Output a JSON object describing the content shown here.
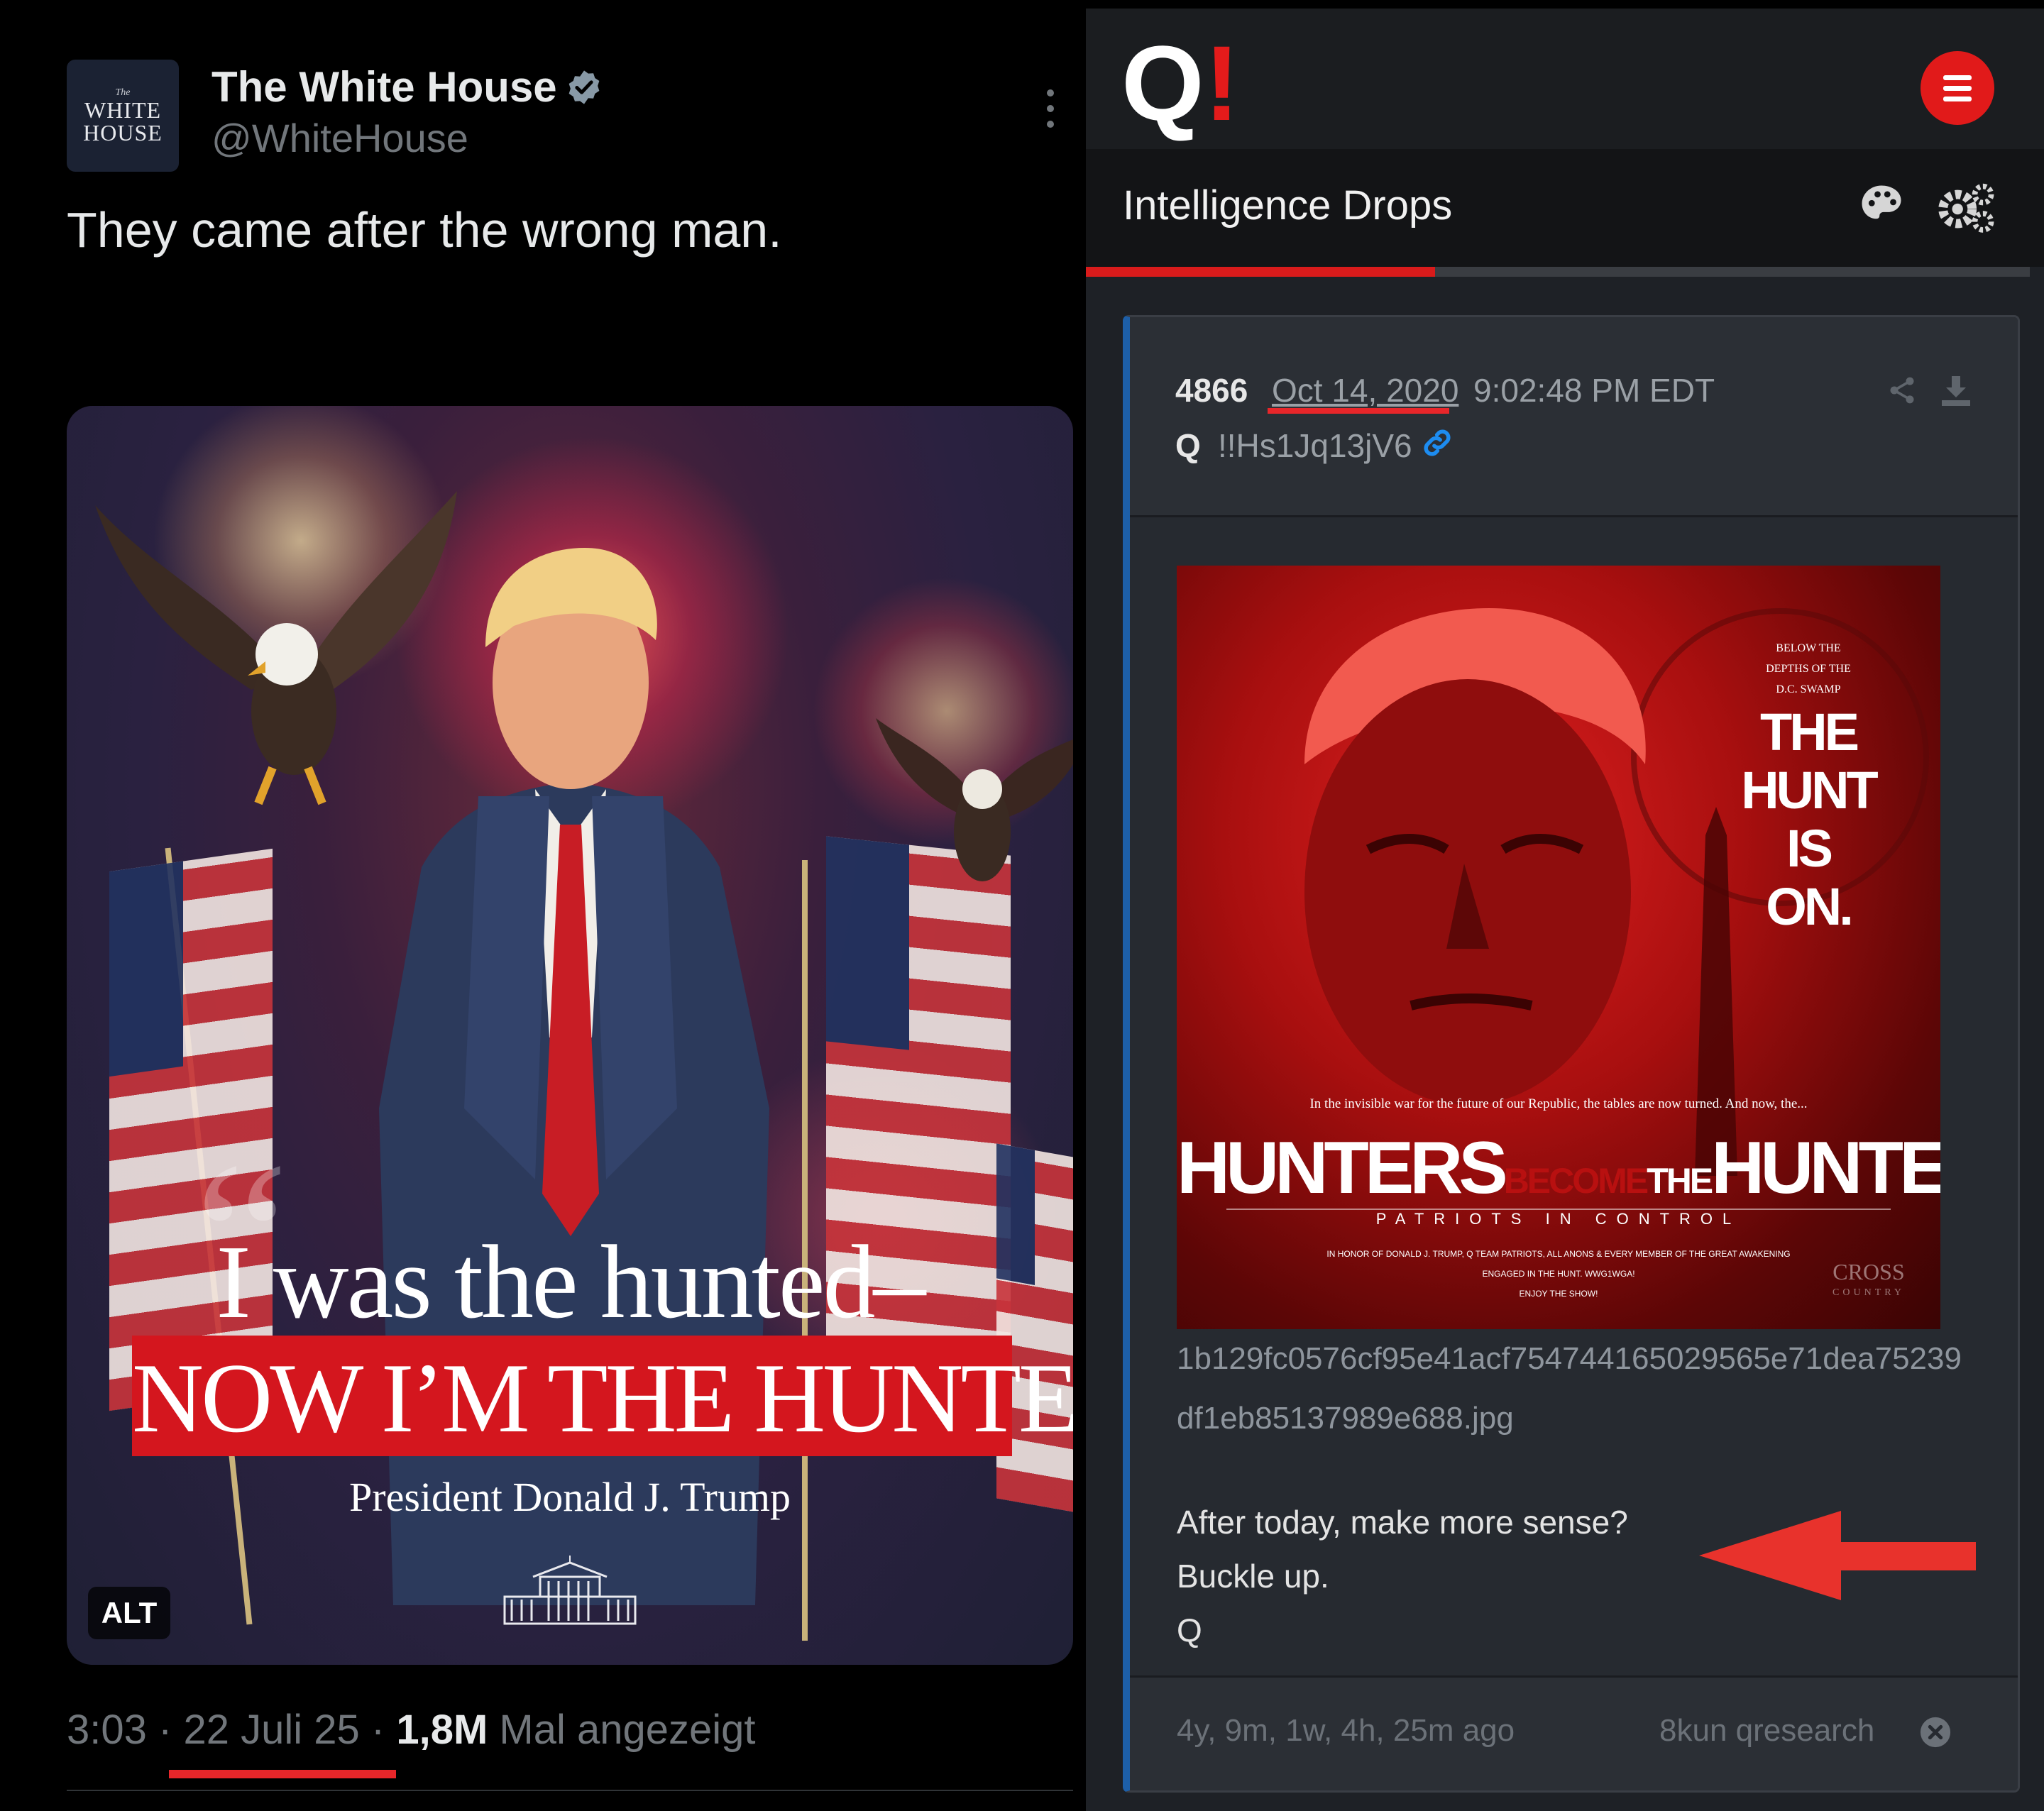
{
  "tweet": {
    "avatar": {
      "line1": "The",
      "line2": "WHITE",
      "line3": "HOUSE"
    },
    "author_name": "The White House",
    "handle": "@WhiteHouse",
    "text": "They came after the wrong man.",
    "image": {
      "quote_line1": "I was the hunted–",
      "quote_line2": "NOW I’M THE HUNTER.",
      "credit": "President Donald J. Trump",
      "alt_badge": "ALT"
    },
    "meta": {
      "time": "3:03",
      "separator": "·",
      "date": "22 Juli 25",
      "views": "1,8M",
      "views_label": "Mal angezeigt"
    }
  },
  "qapp": {
    "logo_q": "Q",
    "logo_bang": "!",
    "section_title": "Intelligence Drops",
    "progress_fraction": 0.37,
    "post": {
      "number": "4866",
      "date": "Oct 14, 2020",
      "time": "9:02:48 PM EDT",
      "author": "Q",
      "tripcode": "!!Hs1Jq13jV6",
      "poster": {
        "small_text": [
          "BELOW THE",
          "DEPTHS OF THE",
          "D.C. SWAMP"
        ],
        "big_text": [
          "THE",
          "HUNT",
          "IS",
          "ON."
        ],
        "caption": "In the invisible war for the future of our Republic, the tables are now turned. And now, the...",
        "headline_1": "HUNTERS",
        "headline_2": "BECOME",
        "headline_3": "THE",
        "headline_4": "HUNTED",
        "subline": "PATRIOTS IN CONTROL",
        "fine_print_1": "In honor of Donald J. Trump, Q Team Patriots, all anons & every member of the Great Awakening engaged in the hunt. WWG1WGA!",
        "fine_print_2": "ENJOY THE SHOW!",
        "logo_main": "CROSS",
        "logo_sub": "COUNTRY"
      },
      "filename": "1b129fc0576cf95e41acf754744165029565e71dea75239df1eb85137989e688.jpg",
      "body_line1": "After today, make more sense?",
      "body_line2": "Buckle up.",
      "body_line3": "Q",
      "age": "4y, 9m, 1w, 4h, 25m ago",
      "source": "8kun qresearch"
    }
  },
  "colors": {
    "accent_red": "#e11a1a",
    "verified_blue": "#8899a6",
    "link_blue": "#1d8cf0",
    "tweet_bg": "#000000",
    "app_bg": "#1e2126"
  },
  "icons": [
    "verified-badge-icon",
    "more-options-icon",
    "menu-icon",
    "palette-icon",
    "settings-icon",
    "share-icon",
    "download-icon",
    "link-icon",
    "close-circle-icon"
  ]
}
